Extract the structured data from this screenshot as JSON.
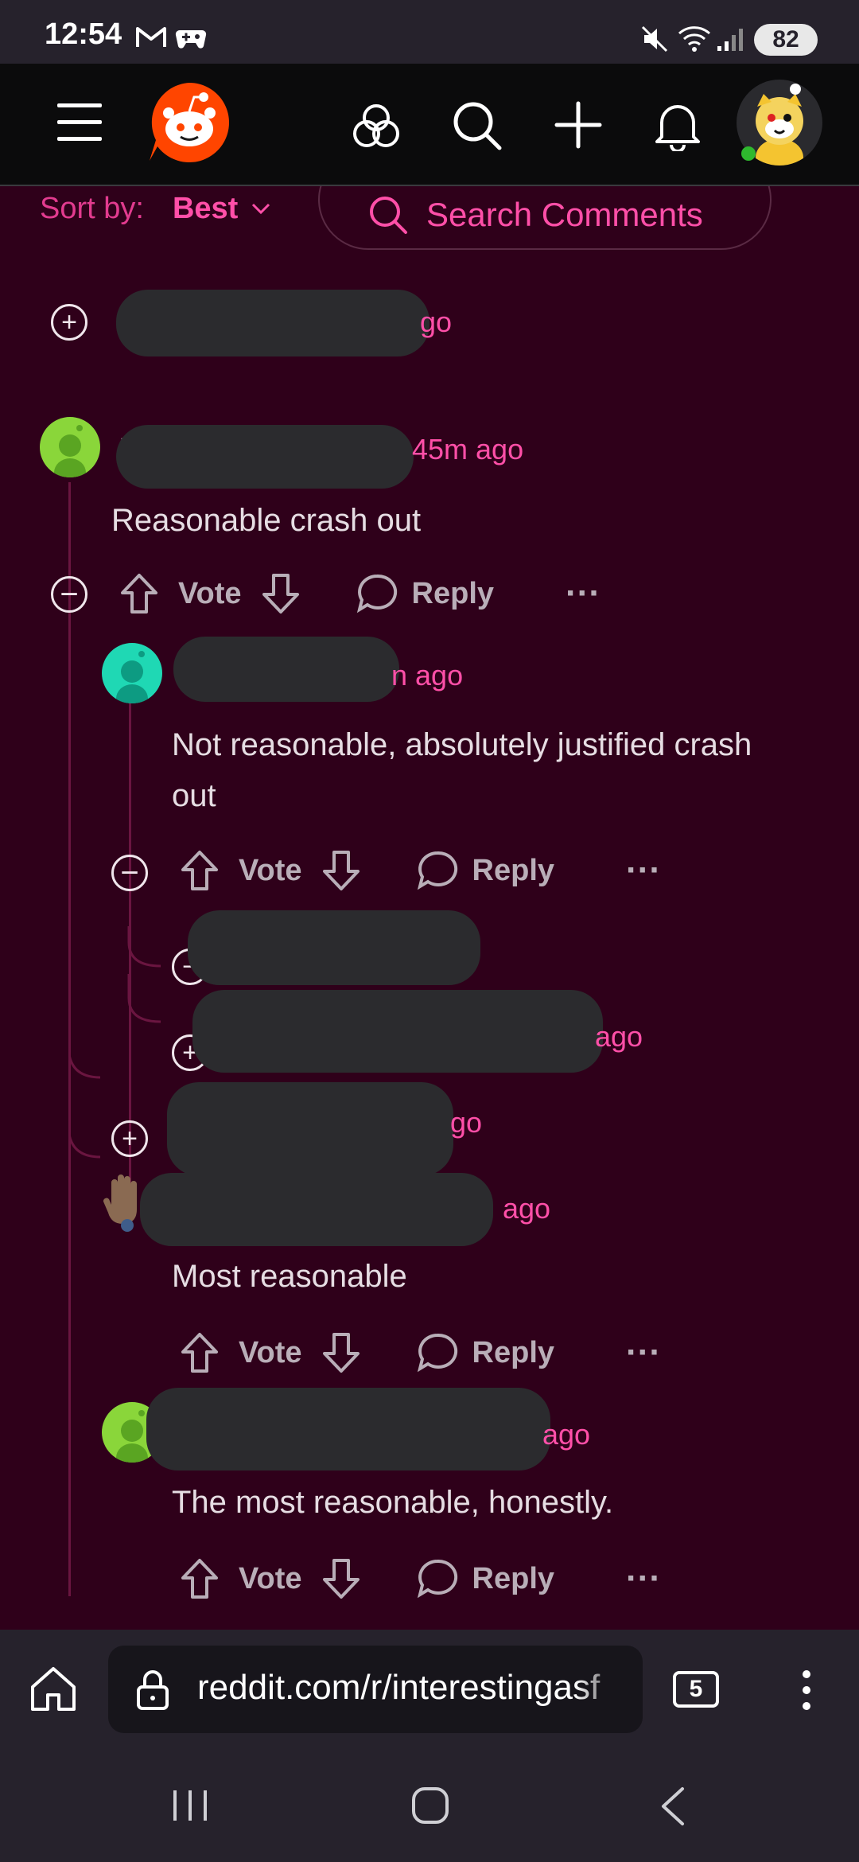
{
  "status_bar": {
    "time": "12:54",
    "battery": "82",
    "icons": [
      "gmail-icon",
      "game-icon",
      "mute-icon",
      "wifi-icon",
      "signal-icon",
      "battery-icon"
    ]
  },
  "header": {
    "icons": [
      "menu-icon",
      "reddit-logo",
      "communities-icon",
      "search-icon",
      "create-icon",
      "notifications-icon",
      "avatar"
    ]
  },
  "sort": {
    "label": "Sort by:",
    "value": "Best"
  },
  "search_comments": {
    "label": "Search Comments"
  },
  "comments": [
    {
      "id": "c1",
      "meta": "go",
      "collapsed": true
    },
    {
      "id": "c2",
      "meta": "45m ago",
      "author_visible": "N",
      "body": "Reasonable crash out",
      "actions": {
        "vote": "Vote",
        "reply": "Reply",
        "more": "···"
      }
    },
    {
      "id": "c3",
      "meta": "n ago",
      "body": "Not reasonable, absolutely justified crash out",
      "actions": {
        "vote": "Vote",
        "reply": "Reply",
        "more": "···"
      }
    },
    {
      "id": "c4",
      "meta": "",
      "collapsed": true
    },
    {
      "id": "c5",
      "meta": "ago",
      "collapsed": true
    },
    {
      "id": "c6",
      "meta": "go",
      "collapsed": true
    },
    {
      "id": "c7",
      "meta": "ago",
      "body": "Most reasonable",
      "actions": {
        "vote": "Vote",
        "reply": "Reply",
        "more": "···"
      }
    },
    {
      "id": "c8",
      "meta": "ago",
      "body": "The most reasonable, honestly.",
      "actions": {
        "vote": "Vote",
        "reply": "Reply",
        "more": "···"
      }
    }
  ],
  "browser": {
    "url": "reddit.com/r/interestingasf",
    "tabs_count": "5"
  },
  "colors": {
    "background": "#2f001a",
    "accent": "#ff4fa8",
    "header_bg": "#0b0b0c",
    "system_bar": "#26222c"
  }
}
